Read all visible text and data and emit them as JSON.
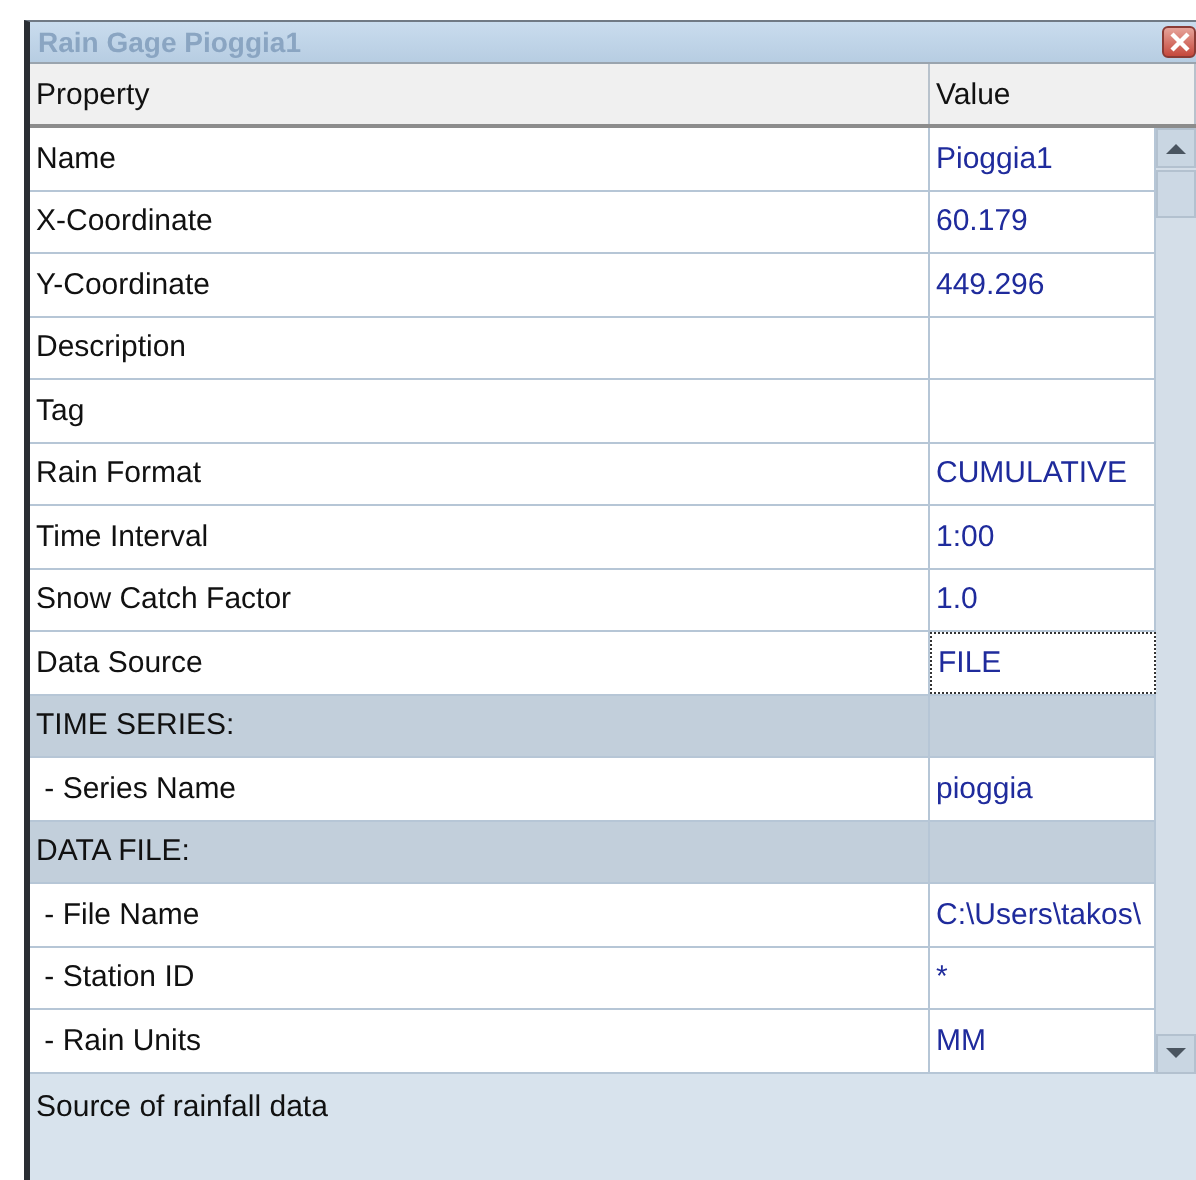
{
  "window": {
    "title": "Rain Gage Pioggia1"
  },
  "table": {
    "columns": [
      "Property",
      "Value"
    ],
    "rows": [
      {
        "kind": "property",
        "property": "Name",
        "value": "Pioggia1",
        "selected": false
      },
      {
        "kind": "property",
        "property": "X-Coordinate",
        "value": "60.179",
        "selected": false
      },
      {
        "kind": "property",
        "property": "Y-Coordinate",
        "value": "449.296",
        "selected": false
      },
      {
        "kind": "property",
        "property": "Description",
        "value": "",
        "selected": false
      },
      {
        "kind": "property",
        "property": "Tag",
        "value": "",
        "selected": false
      },
      {
        "kind": "property",
        "property": "Rain Format",
        "value": "CUMULATIVE",
        "selected": false
      },
      {
        "kind": "property",
        "property": "Time Interval",
        "value": "1:00",
        "selected": false
      },
      {
        "kind": "property",
        "property": "Snow Catch Factor",
        "value": "1.0",
        "selected": false
      },
      {
        "kind": "property",
        "property": "Data Source",
        "value": "FILE",
        "selected": true
      },
      {
        "kind": "section",
        "property": "TIME SERIES:"
      },
      {
        "kind": "property",
        "property": " - Series Name",
        "value": "pioggia",
        "selected": false
      },
      {
        "kind": "section",
        "property": "DATA FILE:"
      },
      {
        "kind": "property",
        "property": " - File Name",
        "value": "C:\\Users\\takos\\",
        "selected": false
      },
      {
        "kind": "property",
        "property": " - Station ID",
        "value": "*",
        "selected": false
      },
      {
        "kind": "property",
        "property": " - Rain Units",
        "value": "MM",
        "selected": false
      }
    ]
  },
  "description": "Source of rainfall data"
}
